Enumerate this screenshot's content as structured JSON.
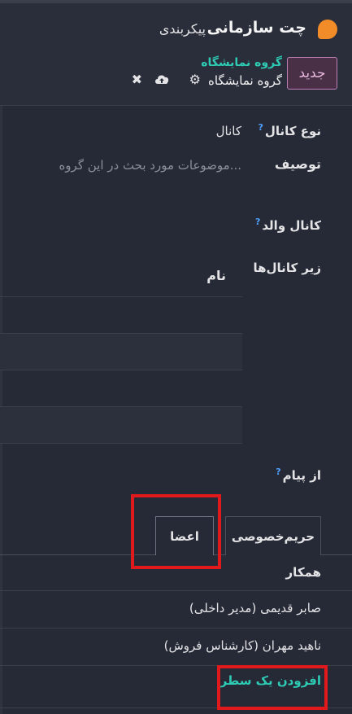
{
  "navbar": {
    "app_title": "چت سازمانی",
    "menu_config": "پیکربندی"
  },
  "control_panel": {
    "new_button": "جدید",
    "breadcrumb_parent": "گروه نمایشگاه",
    "breadcrumb_current": "گروه نمایشگاه",
    "icons": [
      "gear-icon",
      "cloud-upload-icon",
      "close-icon"
    ]
  },
  "form": {
    "channel_type_label": "نوع کانال",
    "channel_type_value": "کانال",
    "description_label": "توصیف",
    "description_placeholder": "موضوعات مورد بحث در این گروه...",
    "parent_channel_label": "کانال والد",
    "sub_channels_label": "زیر کانال‌ها",
    "sub_channels_table": {
      "columns": [
        "نام"
      ],
      "rows": []
    },
    "from_message_label": "از پیام",
    "help_marker": "?"
  },
  "tabs": [
    {
      "label": "حریم‌خصوصی",
      "active": false
    },
    {
      "label": "اعضا",
      "active": true
    }
  ],
  "members": {
    "column_header": "همکار",
    "rows": [
      "صابر قدیمی (مدیر داخلی)",
      "ناهید مهران (کارشناس فروش)"
    ],
    "add_line": "افزودن یک سطر"
  },
  "colors": {
    "background": "#262a36",
    "accent_teal": "#2ecbb4",
    "highlight_red": "#e0191c",
    "new_button_border": "#c07eb6"
  }
}
